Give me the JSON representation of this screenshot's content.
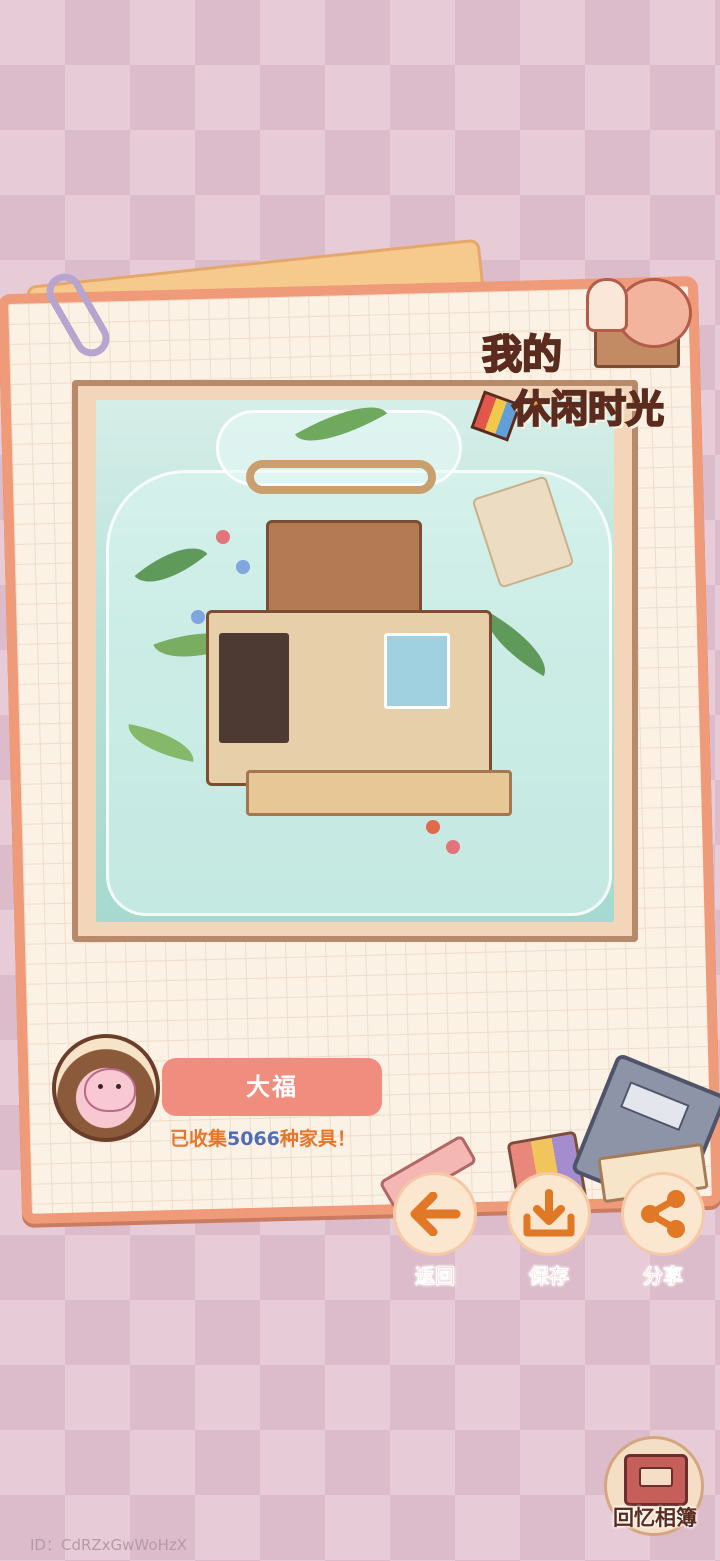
{
  "title": {
    "line1": "我的",
    "line2": "休闲时光"
  },
  "user": {
    "name": "大福",
    "collected_prefix": "已收集",
    "collected_count": "5066",
    "collected_suffix": "种家具！"
  },
  "actions": {
    "back_label": "返回",
    "save_label": "保存",
    "share_label": "分享"
  },
  "album": {
    "label": "回忆相簿"
  },
  "player_id": "ID：CdRZxGwWoHzX",
  "colors": {
    "background_checker_light": "#e7ccd7",
    "background_checker_dark": "#dcbccb",
    "card_border": "#ef9a78",
    "name_pill": "#f08d7e",
    "collect_text": "#e3772e",
    "collect_number": "#4f6fb5",
    "action_label": "#d6552d",
    "action_icon": "#e07826"
  },
  "icons": {
    "back": "arrow-left-icon",
    "save": "download-icon",
    "share": "share-icon",
    "album": "album-book-icon"
  }
}
